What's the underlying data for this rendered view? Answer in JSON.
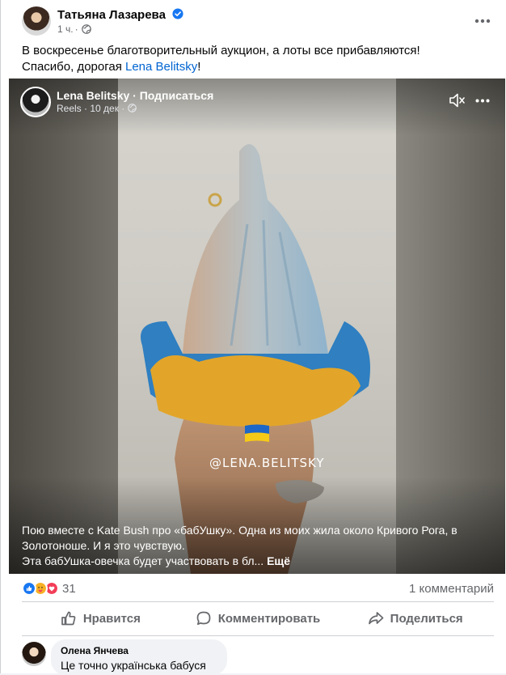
{
  "post": {
    "author": "Татьяна Лазарева",
    "time": "1 ч.",
    "text_line1": "В воскресенье благотворительный аукцион, а лоты все прибавляются!",
    "text_line2_prefix": "Спасибо, дорогая ",
    "text_line2_link": "Lena Belitsky",
    "text_line2_suffix": "!"
  },
  "reel": {
    "author": "Lena Belitsky · Подписаться",
    "meta": "Reels · 10 дек ·",
    "watermark": "@LENA.BELITSKY",
    "caption_line1": "Пою вместе с Kate Bush про «бабУшку». Одна из моих жила около Кривого Рога, в",
    "caption_line2": "Золотоноше. И я это чувствую.",
    "caption_line3": "Эта бабУшка-овечка будет участвовать в бл...",
    "caption_more": "Ещё"
  },
  "stats": {
    "reaction_count": "31",
    "comments_count": "1 комментарий",
    "reactions": [
      "like-reaction",
      "care-reaction",
      "love-reaction"
    ]
  },
  "actions": {
    "like_label": "Нравится",
    "comment_label": "Комментировать",
    "share_label": "Поделиться"
  },
  "comment": {
    "author": "Олена Янчева",
    "text": "Це точно українська бабуся"
  },
  "colors": {
    "link": "#0064d1",
    "secondary_text": "#65676b",
    "like_blue": "#1877f2",
    "love_red": "#f33e58",
    "care_yellow": "#f7b125"
  }
}
